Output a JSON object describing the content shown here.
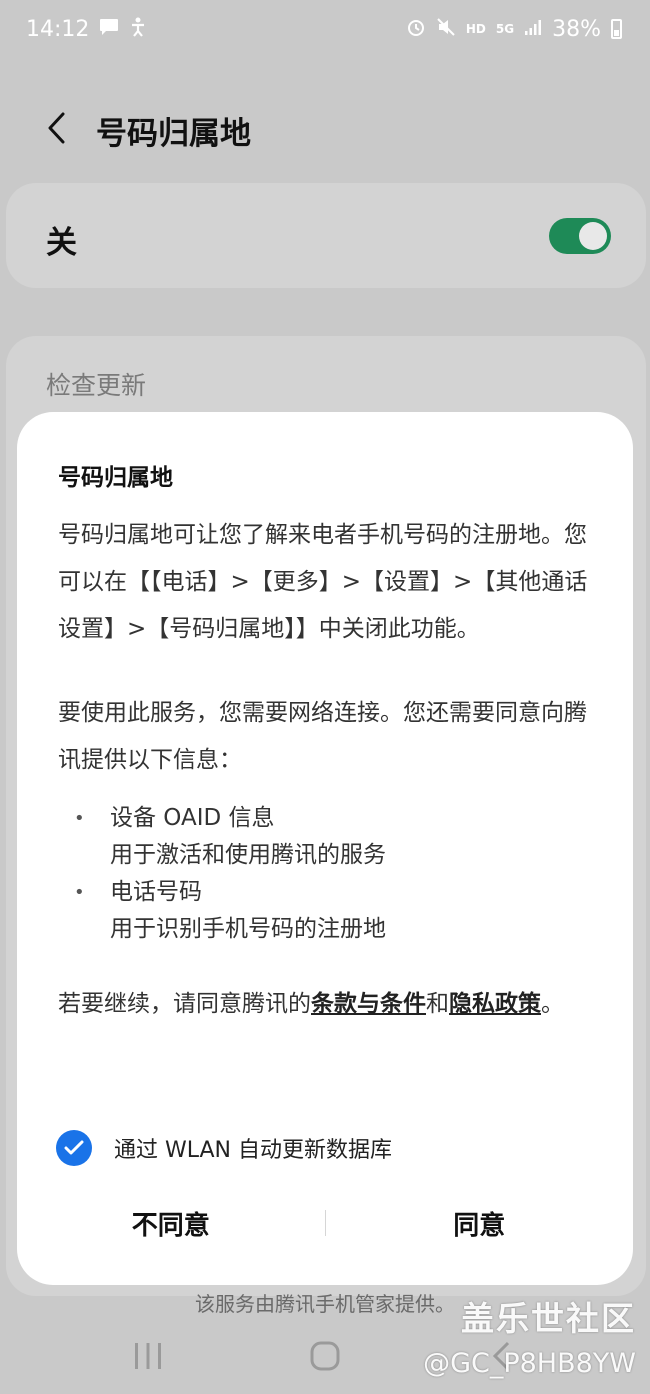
{
  "status_bar": {
    "time": "14:12",
    "network_hd": "HD",
    "network_5g": "5G",
    "battery": "38%"
  },
  "header": {
    "title": "号码归属地"
  },
  "toggle": {
    "label": "关",
    "state": "on",
    "color": "#1e8a57"
  },
  "settings": {
    "check_update": "检查更新",
    "provider_note": "该服务由腾讯手机管家提供。"
  },
  "dialog": {
    "title": "号码归属地",
    "paragraph1": "号码归属地可让您了解来电者手机号码的注册地。您可以在【【电话】>【更多】>【设置】>【其他通话设置】>【号码归属地】】中关闭此功能。",
    "paragraph2": "要使用此服务，您需要网络连接。您还需要同意向腾讯提供以下信息：",
    "bullets": [
      {
        "title": "设备 OAID 信息",
        "desc": "用于激活和使用腾讯的服务"
      },
      {
        "title": "电话号码",
        "desc": "用于识别手机号码的注册地"
      }
    ],
    "consent_prefix": "若要继续，请同意腾讯的",
    "terms_link": "条款与条件",
    "consent_and": "和",
    "privacy_link": "隐私政策",
    "consent_suffix": "。",
    "checkbox_label": "通过 WLAN 自动更新数据库",
    "checkbox_checked": true,
    "disagree_label": "不同意",
    "agree_label": "同意"
  },
  "watermark": {
    "line1": "盖乐世社区",
    "line2": "@GC_P8HB8YW"
  },
  "colors": {
    "accent_blue": "#1a73e8",
    "toggle_green": "#1e8a57"
  }
}
